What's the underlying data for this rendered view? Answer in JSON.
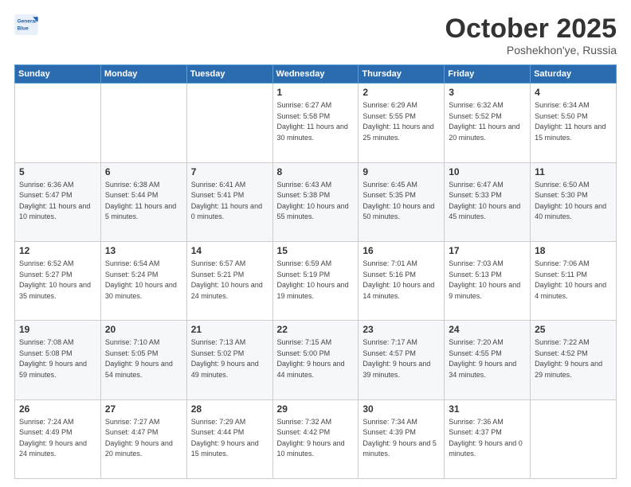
{
  "header": {
    "logo_line1": "General",
    "logo_line2": "Blue",
    "month": "October 2025",
    "location": "Poshekhon'ye, Russia"
  },
  "days_of_week": [
    "Sunday",
    "Monday",
    "Tuesday",
    "Wednesday",
    "Thursday",
    "Friday",
    "Saturday"
  ],
  "weeks": [
    [
      {
        "num": "",
        "sunrise": "",
        "sunset": "",
        "daylight": ""
      },
      {
        "num": "",
        "sunrise": "",
        "sunset": "",
        "daylight": ""
      },
      {
        "num": "",
        "sunrise": "",
        "sunset": "",
        "daylight": ""
      },
      {
        "num": "1",
        "sunrise": "Sunrise: 6:27 AM",
        "sunset": "Sunset: 5:58 PM",
        "daylight": "Daylight: 11 hours and 30 minutes."
      },
      {
        "num": "2",
        "sunrise": "Sunrise: 6:29 AM",
        "sunset": "Sunset: 5:55 PM",
        "daylight": "Daylight: 11 hours and 25 minutes."
      },
      {
        "num": "3",
        "sunrise": "Sunrise: 6:32 AM",
        "sunset": "Sunset: 5:52 PM",
        "daylight": "Daylight: 11 hours and 20 minutes."
      },
      {
        "num": "4",
        "sunrise": "Sunrise: 6:34 AM",
        "sunset": "Sunset: 5:50 PM",
        "daylight": "Daylight: 11 hours and 15 minutes."
      }
    ],
    [
      {
        "num": "5",
        "sunrise": "Sunrise: 6:36 AM",
        "sunset": "Sunset: 5:47 PM",
        "daylight": "Daylight: 11 hours and 10 minutes."
      },
      {
        "num": "6",
        "sunrise": "Sunrise: 6:38 AM",
        "sunset": "Sunset: 5:44 PM",
        "daylight": "Daylight: 11 hours and 5 minutes."
      },
      {
        "num": "7",
        "sunrise": "Sunrise: 6:41 AM",
        "sunset": "Sunset: 5:41 PM",
        "daylight": "Daylight: 11 hours and 0 minutes."
      },
      {
        "num": "8",
        "sunrise": "Sunrise: 6:43 AM",
        "sunset": "Sunset: 5:38 PM",
        "daylight": "Daylight: 10 hours and 55 minutes."
      },
      {
        "num": "9",
        "sunrise": "Sunrise: 6:45 AM",
        "sunset": "Sunset: 5:35 PM",
        "daylight": "Daylight: 10 hours and 50 minutes."
      },
      {
        "num": "10",
        "sunrise": "Sunrise: 6:47 AM",
        "sunset": "Sunset: 5:33 PM",
        "daylight": "Daylight: 10 hours and 45 minutes."
      },
      {
        "num": "11",
        "sunrise": "Sunrise: 6:50 AM",
        "sunset": "Sunset: 5:30 PM",
        "daylight": "Daylight: 10 hours and 40 minutes."
      }
    ],
    [
      {
        "num": "12",
        "sunrise": "Sunrise: 6:52 AM",
        "sunset": "Sunset: 5:27 PM",
        "daylight": "Daylight: 10 hours and 35 minutes."
      },
      {
        "num": "13",
        "sunrise": "Sunrise: 6:54 AM",
        "sunset": "Sunset: 5:24 PM",
        "daylight": "Daylight: 10 hours and 30 minutes."
      },
      {
        "num": "14",
        "sunrise": "Sunrise: 6:57 AM",
        "sunset": "Sunset: 5:21 PM",
        "daylight": "Daylight: 10 hours and 24 minutes."
      },
      {
        "num": "15",
        "sunrise": "Sunrise: 6:59 AM",
        "sunset": "Sunset: 5:19 PM",
        "daylight": "Daylight: 10 hours and 19 minutes."
      },
      {
        "num": "16",
        "sunrise": "Sunrise: 7:01 AM",
        "sunset": "Sunset: 5:16 PM",
        "daylight": "Daylight: 10 hours and 14 minutes."
      },
      {
        "num": "17",
        "sunrise": "Sunrise: 7:03 AM",
        "sunset": "Sunset: 5:13 PM",
        "daylight": "Daylight: 10 hours and 9 minutes."
      },
      {
        "num": "18",
        "sunrise": "Sunrise: 7:06 AM",
        "sunset": "Sunset: 5:11 PM",
        "daylight": "Daylight: 10 hours and 4 minutes."
      }
    ],
    [
      {
        "num": "19",
        "sunrise": "Sunrise: 7:08 AM",
        "sunset": "Sunset: 5:08 PM",
        "daylight": "Daylight: 9 hours and 59 minutes."
      },
      {
        "num": "20",
        "sunrise": "Sunrise: 7:10 AM",
        "sunset": "Sunset: 5:05 PM",
        "daylight": "Daylight: 9 hours and 54 minutes."
      },
      {
        "num": "21",
        "sunrise": "Sunrise: 7:13 AM",
        "sunset": "Sunset: 5:02 PM",
        "daylight": "Daylight: 9 hours and 49 minutes."
      },
      {
        "num": "22",
        "sunrise": "Sunrise: 7:15 AM",
        "sunset": "Sunset: 5:00 PM",
        "daylight": "Daylight: 9 hours and 44 minutes."
      },
      {
        "num": "23",
        "sunrise": "Sunrise: 7:17 AM",
        "sunset": "Sunset: 4:57 PM",
        "daylight": "Daylight: 9 hours and 39 minutes."
      },
      {
        "num": "24",
        "sunrise": "Sunrise: 7:20 AM",
        "sunset": "Sunset: 4:55 PM",
        "daylight": "Daylight: 9 hours and 34 minutes."
      },
      {
        "num": "25",
        "sunrise": "Sunrise: 7:22 AM",
        "sunset": "Sunset: 4:52 PM",
        "daylight": "Daylight: 9 hours and 29 minutes."
      }
    ],
    [
      {
        "num": "26",
        "sunrise": "Sunrise: 7:24 AM",
        "sunset": "Sunset: 4:49 PM",
        "daylight": "Daylight: 9 hours and 24 minutes."
      },
      {
        "num": "27",
        "sunrise": "Sunrise: 7:27 AM",
        "sunset": "Sunset: 4:47 PM",
        "daylight": "Daylight: 9 hours and 20 minutes."
      },
      {
        "num": "28",
        "sunrise": "Sunrise: 7:29 AM",
        "sunset": "Sunset: 4:44 PM",
        "daylight": "Daylight: 9 hours and 15 minutes."
      },
      {
        "num": "29",
        "sunrise": "Sunrise: 7:32 AM",
        "sunset": "Sunset: 4:42 PM",
        "daylight": "Daylight: 9 hours and 10 minutes."
      },
      {
        "num": "30",
        "sunrise": "Sunrise: 7:34 AM",
        "sunset": "Sunset: 4:39 PM",
        "daylight": "Daylight: 9 hours and 5 minutes."
      },
      {
        "num": "31",
        "sunrise": "Sunrise: 7:36 AM",
        "sunset": "Sunset: 4:37 PM",
        "daylight": "Daylight: 9 hours and 0 minutes."
      },
      {
        "num": "",
        "sunrise": "",
        "sunset": "",
        "daylight": ""
      }
    ]
  ],
  "colors": {
    "header_bg": "#2b6cb0",
    "logo_blue": "#1a5fa8"
  }
}
